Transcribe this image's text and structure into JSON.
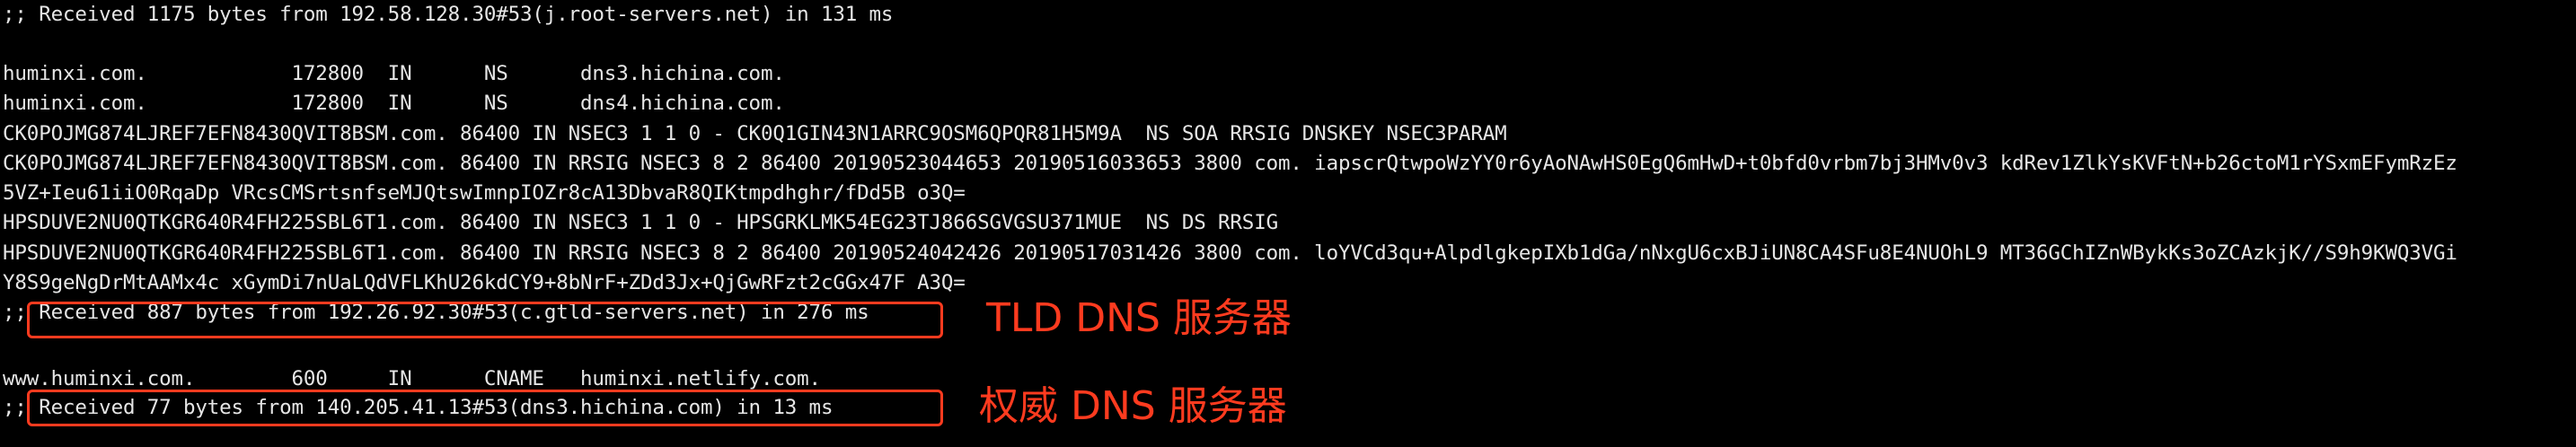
{
  "terminal": {
    "lines": [
      ";; Received 1175 bytes from 192.58.128.30#53(j.root-servers.net) in 131 ms",
      "",
      "huminxi.com.            172800  IN      NS      dns3.hichina.com.",
      "huminxi.com.            172800  IN      NS      dns4.hichina.com.",
      "CK0POJMG874LJREF7EFN8430QVIT8BSM.com. 86400 IN NSEC3 1 1 0 - CK0Q1GIN43N1ARRC9OSM6QPQR81H5M9A  NS SOA RRSIG DNSKEY NSEC3PARAM",
      "CK0POJMG874LJREF7EFN8430QVIT8BSM.com. 86400 IN RRSIG NSEC3 8 2 86400 20190523044653 20190516033653 3800 com. iapscrQtwpoWzYY0r6yAoNAwHS0EgQ6mHwD+t0bfd0vrbm7bj3HMv0v3 kdRev1ZlkYsKVFtN+b26ctoM1rYSxmEFymRzEz",
      "5VZ+Ieu61iiO0RqaDp VRcsCMSrtsnfseMJQtswImnpIOZr8cA13DbvaR8QIKtmpdhghr/fDd5B o3Q=",
      "HPSDUVE2NU0QTKGR640R4FH225SBL6T1.com. 86400 IN NSEC3 1 1 0 - HPSGRKLMK54EG23TJ866SGVGSU371MUE  NS DS RRSIG",
      "HPSDUVE2NU0QTKGR640R4FH225SBL6T1.com. 86400 IN RRSIG NSEC3 8 2 86400 20190524042426 20190517031426 3800 com. loYVCd3qu+AlpdlgkepIXb1dGa/nNxgU6cxBJiUN8CA4SFu8E4NUOhL9 MT36GChIZnWBykKs3oZCAzkjK//S9h9KWQ3VGi",
      "Y8S9geNgDrMtAAMx4c xGymDi7nUaLQdVFLKhU26kdCY9+8bNrF+ZDd3Jx+QjGwRFzt2cGGx47F A3Q=",
      ";; Received 887 bytes from 192.26.92.30#53(c.gtld-servers.net) in 276 ms",
      "",
      "www.huminxi.com.        600     IN      CNAME   huminxi.netlify.com.",
      ";; Received 77 bytes from 140.205.41.13#53(dns3.hichina.com) in 13 ms"
    ]
  },
  "annotations": {
    "tld_label": "TLD DNS 服务器",
    "auth_label": "权威 DNS 服务器",
    "accent_color": "#ff3b1f"
  }
}
